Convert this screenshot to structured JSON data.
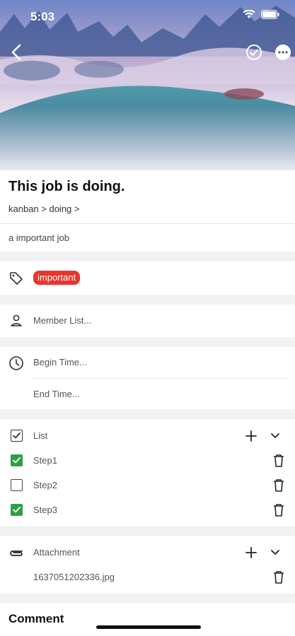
{
  "status_bar": {
    "time": "5:03"
  },
  "task": {
    "title": "This job is doing.",
    "breadcrumb": "kanban > doing >",
    "description": "a important job"
  },
  "tags": {
    "items": [
      "important"
    ],
    "color": "#e8352b"
  },
  "members": {
    "placeholder": "Member List..."
  },
  "time": {
    "begin_placeholder": "Begin Time...",
    "end_placeholder": "End Time..."
  },
  "checklist": {
    "header": "List",
    "steps": [
      {
        "label": "Step1",
        "checked": true
      },
      {
        "label": "Step2",
        "checked": false
      },
      {
        "label": "Step3",
        "checked": true
      }
    ],
    "check_color": "#2ea043"
  },
  "attachment": {
    "header": "Attachment",
    "files": [
      "1637051202336.jpg"
    ]
  },
  "comment": {
    "header": "Comment"
  },
  "icons": {
    "back": "chevron-left-icon",
    "done": "check-circle-icon",
    "more": "more-icon",
    "tag": "tag-icon",
    "member": "person-icon",
    "clock": "clock-icon",
    "list": "checkbox-icon",
    "attachment": "paperclip-icon",
    "add": "plus-icon",
    "expand": "chevron-down-icon",
    "delete": "trash-icon"
  }
}
